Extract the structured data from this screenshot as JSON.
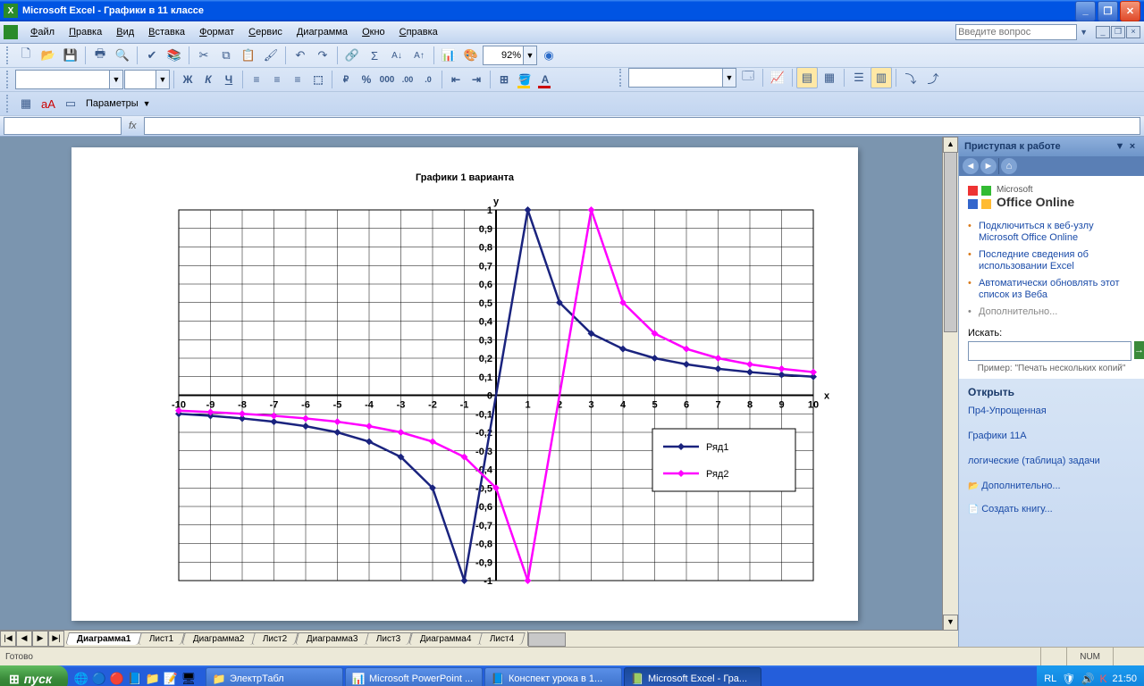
{
  "window": {
    "title": "Microsoft Excel - Графики в 11 классе"
  },
  "menu": {
    "items": [
      "Файл",
      "Правка",
      "Вид",
      "Вставка",
      "Формат",
      "Сервис",
      "Диаграмма",
      "Окно",
      "Справка"
    ],
    "question_placeholder": "Введите вопрос"
  },
  "toolbar": {
    "zoom": "92%",
    "params": "Параметры"
  },
  "taskpane": {
    "title": "Приступая к работе",
    "office_small": "Microsoft",
    "office_big": "Office Online",
    "links": [
      "Подключиться к веб-узлу Microsoft Office Online",
      "Последние сведения об использовании Excel",
      "Автоматически обновлять этот список из Веба"
    ],
    "more": "Дополнительно...",
    "search_label": "Искать:",
    "search_example": "Пример:  \"Печать нескольких копий\"",
    "open_title": "Открыть",
    "open_links": [
      "Пр4-Упрощенная",
      "Графики 11А",
      "логические (таблица) задачи"
    ],
    "open_more": "Дополнительно...",
    "create": "Создать книгу..."
  },
  "sheets": {
    "tabs": [
      "Диаграмма1",
      "Лист1",
      "Диаграмма2",
      "Лист2",
      "Диаграмма3",
      "Лист3",
      "Диаграмма4",
      "Лист4"
    ],
    "active": 0
  },
  "status": {
    "ready": "Готово",
    "num": "NUM"
  },
  "taskbar": {
    "start": "пуск",
    "tasks": [
      {
        "icon": "📁",
        "label": "ЭлектрТабл",
        "active": false
      },
      {
        "icon": "📊",
        "label": "Microsoft PowerPoint ...",
        "active": false
      },
      {
        "icon": "📘",
        "label": "Конспект урока в 1...",
        "active": false
      },
      {
        "icon": "📗",
        "label": "Microsoft Excel - Гра...",
        "active": true
      }
    ],
    "lang": "RL",
    "time": "21:50"
  },
  "chart_data": {
    "type": "line",
    "title": "Графики 1 варианта",
    "xlabel": "x",
    "ylabel": "y",
    "xlim": [
      -10,
      10
    ],
    "ylim": [
      -1,
      1
    ],
    "xticks": [
      -10,
      -9,
      -8,
      -7,
      -6,
      -5,
      -4,
      -3,
      -2,
      -1,
      0,
      1,
      2,
      3,
      4,
      5,
      6,
      7,
      8,
      9,
      10
    ],
    "yticks": [
      -1,
      -0.9,
      -0.8,
      -0.7,
      -0.6,
      -0.5,
      -0.4,
      -0.3,
      -0.2,
      -0.1,
      0,
      0.1,
      0.2,
      0.3,
      0.4,
      0.5,
      0.6,
      0.7,
      0.8,
      0.9,
      1
    ],
    "series": [
      {
        "name": "Ряд1",
        "color": "#1a237e",
        "x": [
          -10,
          -9,
          -8,
          -7,
          -6,
          -5,
          -4,
          -3,
          -2,
          -1,
          1,
          2,
          3,
          4,
          5,
          6,
          7,
          8,
          9,
          10
        ],
        "y": [
          -0.1,
          -0.111,
          -0.125,
          -0.143,
          -0.167,
          -0.2,
          -0.25,
          -0.333,
          -0.5,
          -1,
          1,
          0.5,
          0.333,
          0.25,
          0.2,
          0.167,
          0.143,
          0.125,
          0.111,
          0.1
        ]
      },
      {
        "name": "Ряд2",
        "color": "#ff00ff",
        "x": [
          -10,
          -9,
          -8,
          -7,
          -6,
          -5,
          -4,
          -3,
          -2,
          -1,
          0,
          1,
          3,
          4,
          5,
          6,
          7,
          8,
          9,
          10
        ],
        "y": [
          -0.083,
          -0.091,
          -0.1,
          -0.111,
          -0.125,
          -0.143,
          -0.167,
          -0.2,
          -0.25,
          -0.333,
          -0.5,
          -1,
          1,
          0.5,
          0.333,
          0.25,
          0.2,
          0.167,
          0.143,
          0.125
        ]
      }
    ],
    "legend": [
      "Ряд1",
      "Ряд2"
    ]
  }
}
